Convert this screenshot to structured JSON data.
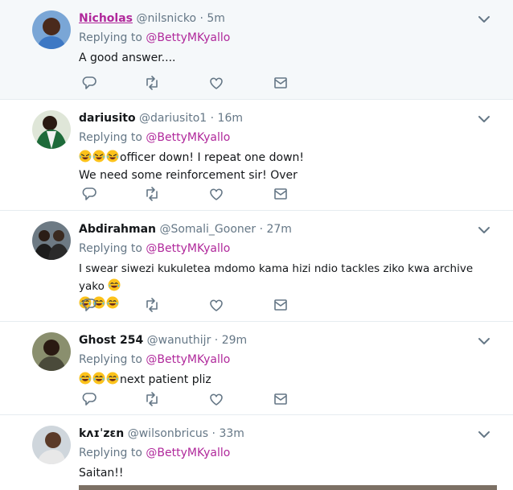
{
  "tweets": [
    {
      "name": "Nicholas",
      "handle": "@nilsnicko",
      "sep": " · ",
      "time": "5m",
      "replying_label": "Replying to ",
      "mention": "@BettyMKyallo",
      "text": "A good answer...."
    },
    {
      "name": "dariusito",
      "handle": "@dariusito1",
      "sep": " · ",
      "time": "16m",
      "replying_label": "Replying to ",
      "mention": "@BettyMKyallo",
      "text_line1": "officer down! I repeat one down!",
      "text_line2": "We need some reinforcement sir! Over"
    },
    {
      "name": "Abdirahman",
      "handle": "@Somali_Gooner",
      "sep": " · ",
      "time": "27m",
      "replying_label": "Replying to ",
      "mention": "@BettyMKyallo",
      "text_line1": "I swear siwezi kukuletea mdomo kama hizi ndio tackles ziko kwa archive yako "
    },
    {
      "name": "Ghost 254",
      "handle": "@wanuthijr",
      "sep": " · ",
      "time": "29m",
      "replying_label": "Replying to ",
      "mention": "@BettyMKyallo",
      "text": "next patient pliz"
    },
    {
      "name": "kʌɪˈzɛn",
      "handle": "@wilsonbricus",
      "sep": " · ",
      "time": "33m",
      "replying_label": "Replying to ",
      "mention": "@BettyMKyallo",
      "text": "Saitan!!"
    }
  ],
  "icons": {
    "reply": "reply-icon",
    "retweet": "retweet-icon",
    "like": "like-icon",
    "dm": "dm-icon",
    "more": "chevron-down-icon"
  },
  "colors": {
    "mention": "#b0289b",
    "muted": "#657786",
    "highlight_bg": "#f5f8fa",
    "divider": "#e6ecf0"
  }
}
